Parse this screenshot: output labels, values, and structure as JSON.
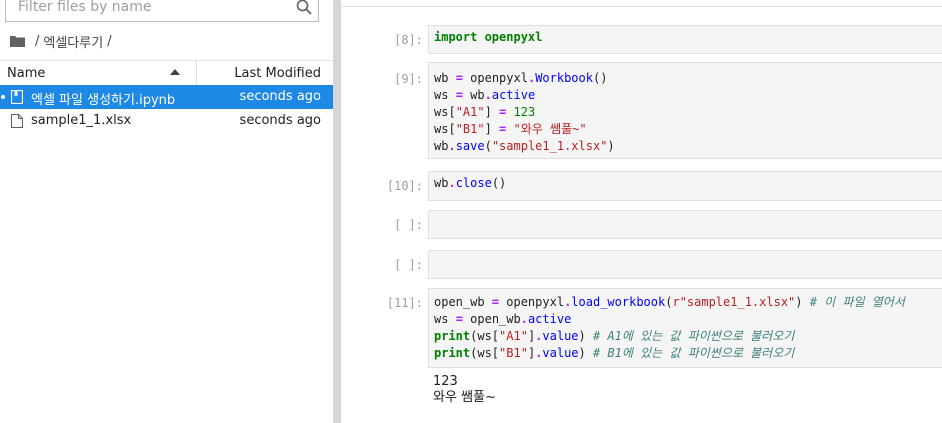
{
  "filebrowser": {
    "search_placeholder": "Filter files by name",
    "breadcrumb": {
      "sep1": "/",
      "folder": "엑셀다루기",
      "sep2": "/"
    },
    "columns": {
      "name": "Name",
      "modified": "Last Modified"
    },
    "files": [
      {
        "name": "엑셀 파일 생성하기.ipynb",
        "modified": "seconds ago",
        "icon": "notebook-icon",
        "selected": true
      },
      {
        "name": "sample1_1.xlsx",
        "modified": "seconds ago",
        "icon": "file-icon",
        "selected": false
      }
    ]
  },
  "notebook": {
    "cells": [
      {
        "prompt": "[8]:",
        "code": [
          "import openpyxl"
        ]
      },
      {
        "prompt": "[9]:",
        "code": [
          "wb = openpyxl.Workbook()",
          "ws = wb.active",
          "ws[\"A1\"] = 123",
          "ws[\"B1\"] = \"와우 쌤풀~\"",
          "wb.save(\"sample1_1.xlsx\")"
        ]
      },
      {
        "prompt": "[10]:",
        "code": [
          "wb.close()"
        ]
      },
      {
        "prompt": "[ ]:",
        "code": []
      },
      {
        "prompt": "[ ]:",
        "code": []
      },
      {
        "prompt": "[11]:",
        "code": [
          "open_wb = openpyxl.load_workbook(r\"sample1_1.xlsx\") # 이 파일 열어서",
          "ws = open_wb.active",
          "print(ws[\"A1\"].value) # A1에 있는 값 파이썬으로 불러오기",
          "print(ws[\"B1\"].value) # B1에 있는 값 파이썬으로 불러오기"
        ],
        "output": [
          "123",
          "와우 쌤풀~"
        ]
      }
    ]
  }
}
